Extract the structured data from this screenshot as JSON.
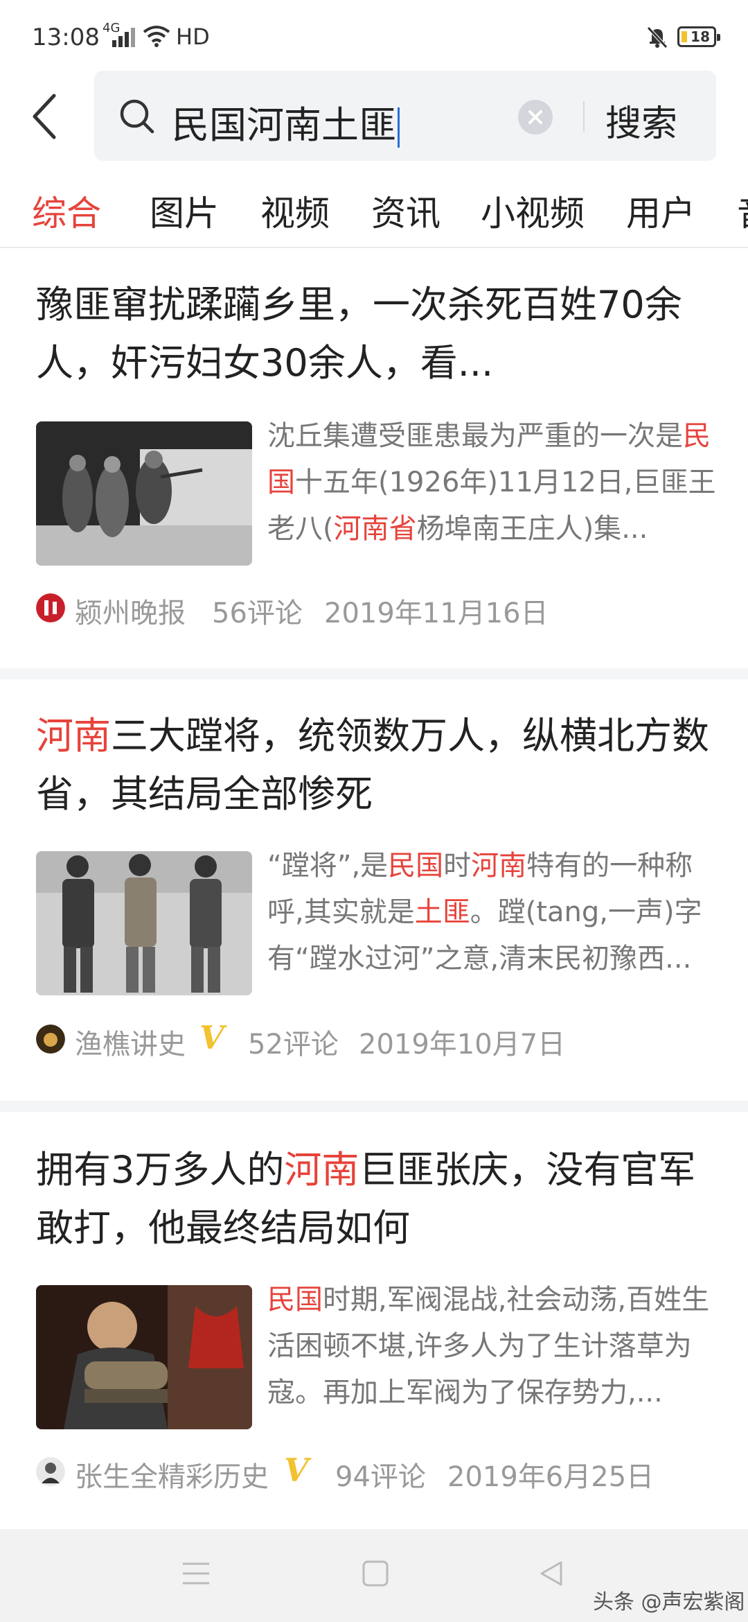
{
  "status_bar": {
    "time": "13:08",
    "network": "4G",
    "hd": "HD",
    "battery": "18"
  },
  "search": {
    "query": "民国河南土匪",
    "submit_label": "搜索"
  },
  "tabs": [
    {
      "label": "综合",
      "active": true
    },
    {
      "label": "图片"
    },
    {
      "label": "视频"
    },
    {
      "label": "资讯"
    },
    {
      "label": "小视频"
    },
    {
      "label": "用户"
    },
    {
      "label": "音"
    }
  ],
  "results": [
    {
      "title_html": "豫匪窜扰蹂躏乡里，一次杀死百姓70余人，奸污妇女30余人，看...",
      "snippet_html": "沈丘集遭受匪患最为严重的一次是<span class=\"hl\">民国</span>十五年(1926年)11月12日,巨匪王老八(<span class=\"hl\">河南省</span>杨埠南王庄人)集...",
      "source": "颍州晚报",
      "verified": false,
      "comments": "56评论",
      "date": "2019年11月16日"
    },
    {
      "title_html": "<span class=\"hl\">河南</span>三大蹚将，统领数万人，纵横北方数省，其结局全部惨死",
      "snippet_html": "“蹚将”,是<span class=\"hl\">民国</span>时<span class=\"hl\">河南</span>特有的一种称呼,其实就是<span class=\"hl\">土匪</span>。蹚(tang,一声)字有“蹚水过河”之意,清末民初豫西...",
      "source": "渔樵讲史",
      "verified": true,
      "comments": "52评论",
      "date": "2019年10月7日"
    },
    {
      "title_html": "拥有3万多人的<span class=\"hl\">河南</span>巨匪张庆，没有官军敢打，他最终结局如何",
      "snippet_html": "<span class=\"hl\">民国</span>时期,军阀混战,社会动荡,百姓生活困顿不堪,许多人为了生计落草为寇。再加上军阀为了保存势力,...",
      "source": "张生全精彩历史",
      "verified": true,
      "comments": "94评论",
      "date": "2019年6月25日"
    }
  ],
  "verified_badge": "V",
  "watermark": "头条 @声宏紫阁",
  "colors": {
    "accent": "#e6433b",
    "muted": "#999999",
    "verified": "#f2c230"
  }
}
